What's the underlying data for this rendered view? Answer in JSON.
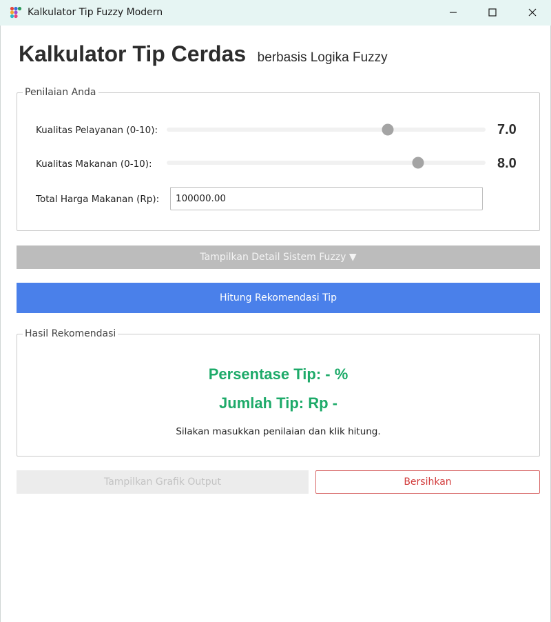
{
  "window": {
    "title": "Kalkulator Tip Fuzzy Modern",
    "icon": "app-dots-icon"
  },
  "header": {
    "title": "Kalkulator Tip Cerdas",
    "subtitle": "berbasis Logika Fuzzy"
  },
  "input_group": {
    "legend": "Penilaian Anda",
    "service": {
      "label": "Kualitas Pelayanan (0-10):",
      "value": 7.0,
      "value_text": "7.0",
      "min": 0,
      "max": 10
    },
    "food": {
      "label": "Kualitas Makanan (0-10):",
      "value": 8.0,
      "value_text": "8.0",
      "min": 0,
      "max": 10
    },
    "price": {
      "label": "Total Harga Makanan (Rp):",
      "value": "100000.00"
    }
  },
  "buttons": {
    "detail": "Tampilkan Detail Sistem Fuzzy ▼",
    "hitung": "Hitung Rekomendasi Tip",
    "grafik": "Tampilkan Grafik Output",
    "clear": "Bersihkan"
  },
  "result_group": {
    "legend": "Hasil Rekomendasi",
    "percent": "Persentase Tip: - %",
    "amount": "Jumlah Tip: Rp -",
    "message": "Silakan masukkan penilaian dan klik hitung."
  },
  "colors": {
    "accent": "#4a80ea",
    "result": "#1daa69",
    "danger": "#d23b3b"
  }
}
